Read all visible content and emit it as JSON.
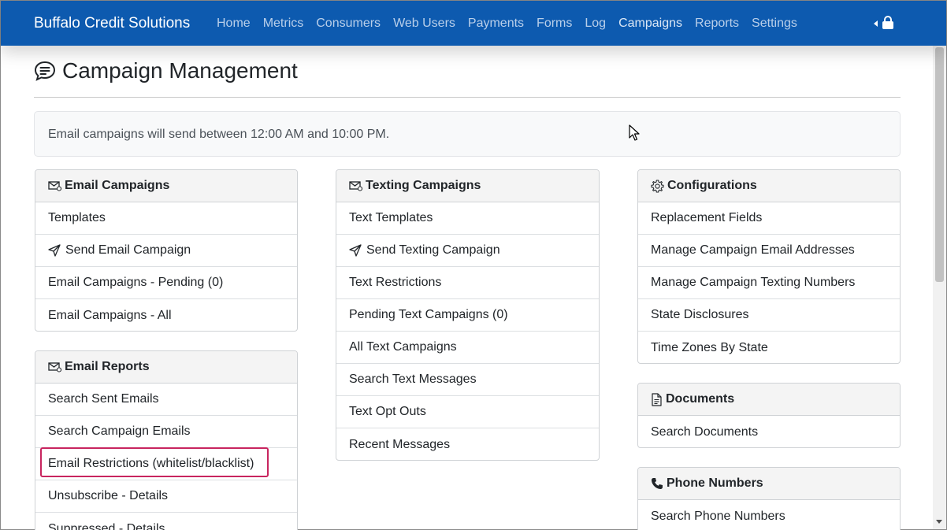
{
  "app": {
    "brand": "Buffalo Credit Solutions",
    "nav": [
      "Home",
      "Metrics",
      "Consumers",
      "Web Users",
      "Payments",
      "Forms",
      "Log",
      "Campaigns",
      "Reports",
      "Settings"
    ]
  },
  "page": {
    "title": "Campaign Management",
    "notice": "Email campaigns will send between 12:00 AM and 10:00 PM."
  },
  "email_campaigns": {
    "header": "Email Campaigns",
    "items": [
      "Templates",
      "Send Email Campaign",
      "Email Campaigns - Pending (0)",
      "Email Campaigns - All"
    ]
  },
  "email_reports": {
    "header": "Email Reports",
    "items": [
      "Search Sent Emails",
      "Search Campaign Emails",
      "Email Restrictions (whitelist/blacklist)",
      "Unsubscribe - Details",
      "Suppressed - Details"
    ]
  },
  "texting_campaigns": {
    "header": "Texting Campaigns",
    "items": [
      "Text Templates",
      "Send Texting Campaign",
      "Text Restrictions",
      "Pending Text Campaigns (0)",
      "All Text Campaigns",
      "Search Text Messages",
      "Text Opt Outs",
      "Recent Messages"
    ]
  },
  "configurations": {
    "header": "Configurations",
    "items": [
      "Replacement Fields",
      "Manage Campaign Email Addresses",
      "Manage Campaign Texting Numbers",
      "State Disclosures",
      "Time Zones By State"
    ]
  },
  "documents": {
    "header": "Documents",
    "items": [
      "Search Documents"
    ]
  },
  "phone_numbers": {
    "header": "Phone Numbers",
    "items": [
      "Search Phone Numbers"
    ]
  },
  "colors": {
    "navbar": "#0d5aaf",
    "highlight": "#c8255f"
  }
}
